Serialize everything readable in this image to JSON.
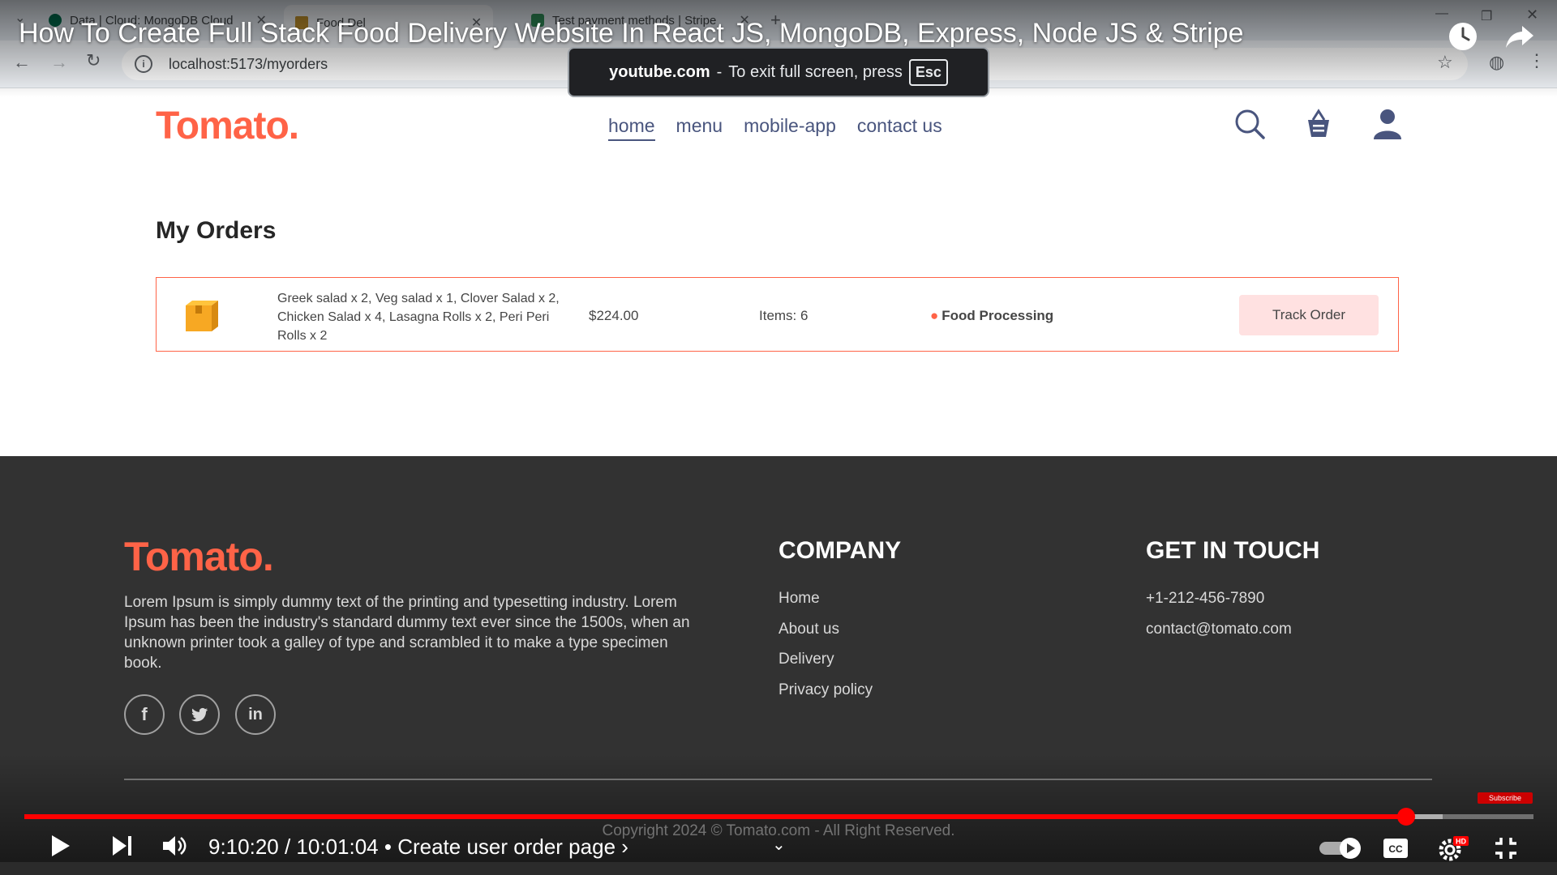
{
  "browser": {
    "tabs": [
      {
        "title": "Data | Cloud: MongoDB Cloud",
        "favicon_color": "#00684a"
      },
      {
        "title": "Food Del",
        "favicon_color": "#bd8e2b"
      },
      {
        "title": "Test payment methods | Stripe",
        "favicon_color": "#2e8b57"
      }
    ],
    "url": "localhost:5173/myorders"
  },
  "video": {
    "title": "How To Create Full Stack Food Delivery Website In React JS, MongoDB, Express, Node JS & Stripe",
    "fullscreen_notice": {
      "site": "youtube.com",
      "message": "To exit full screen, press",
      "key": "Esc"
    },
    "time_current": "9:10:20",
    "time_total": "10:01:04",
    "chapter": "Create user order page",
    "progress_fraction": 0.9155,
    "buffer_fraction": 0.94,
    "subscribe_label": "Subscribe"
  },
  "site": {
    "logo": "Tomato.",
    "nav": [
      "home",
      "menu",
      "mobile-app",
      "contact us"
    ],
    "active_nav": "home",
    "accent": "#ff6347"
  },
  "orders": {
    "heading": "My Orders",
    "rows": [
      {
        "items": "Greek salad x 2, Veg salad x 1, Clover Salad x 2, Chicken Salad x 4, Lasagna Rolls x 2, Peri Peri Rolls x 2",
        "amount": "$224.00",
        "count": "Items: 6",
        "status": "Food Processing",
        "action": "Track Order"
      }
    ]
  },
  "footer": {
    "logo": "Tomato.",
    "description": "Lorem Ipsum is simply dummy text of the printing and typesetting industry. Lorem Ipsum has been the industry's standard dummy text ever since the 1500s, when an unknown printer took a galley of type and scrambled it to make a type specimen book.",
    "social": [
      "facebook-icon",
      "twitter-icon",
      "linkedin-icon"
    ],
    "company_heading": "COMPANY",
    "company_links": [
      "Home",
      "About us",
      "Delivery",
      "Privacy policy"
    ],
    "contact_heading": "GET IN TOUCH",
    "phone": "+1-212-456-7890",
    "email": "contact@tomato.com",
    "copyright": "Copyright 2024 © Tomato.com - All Right Reserved."
  }
}
